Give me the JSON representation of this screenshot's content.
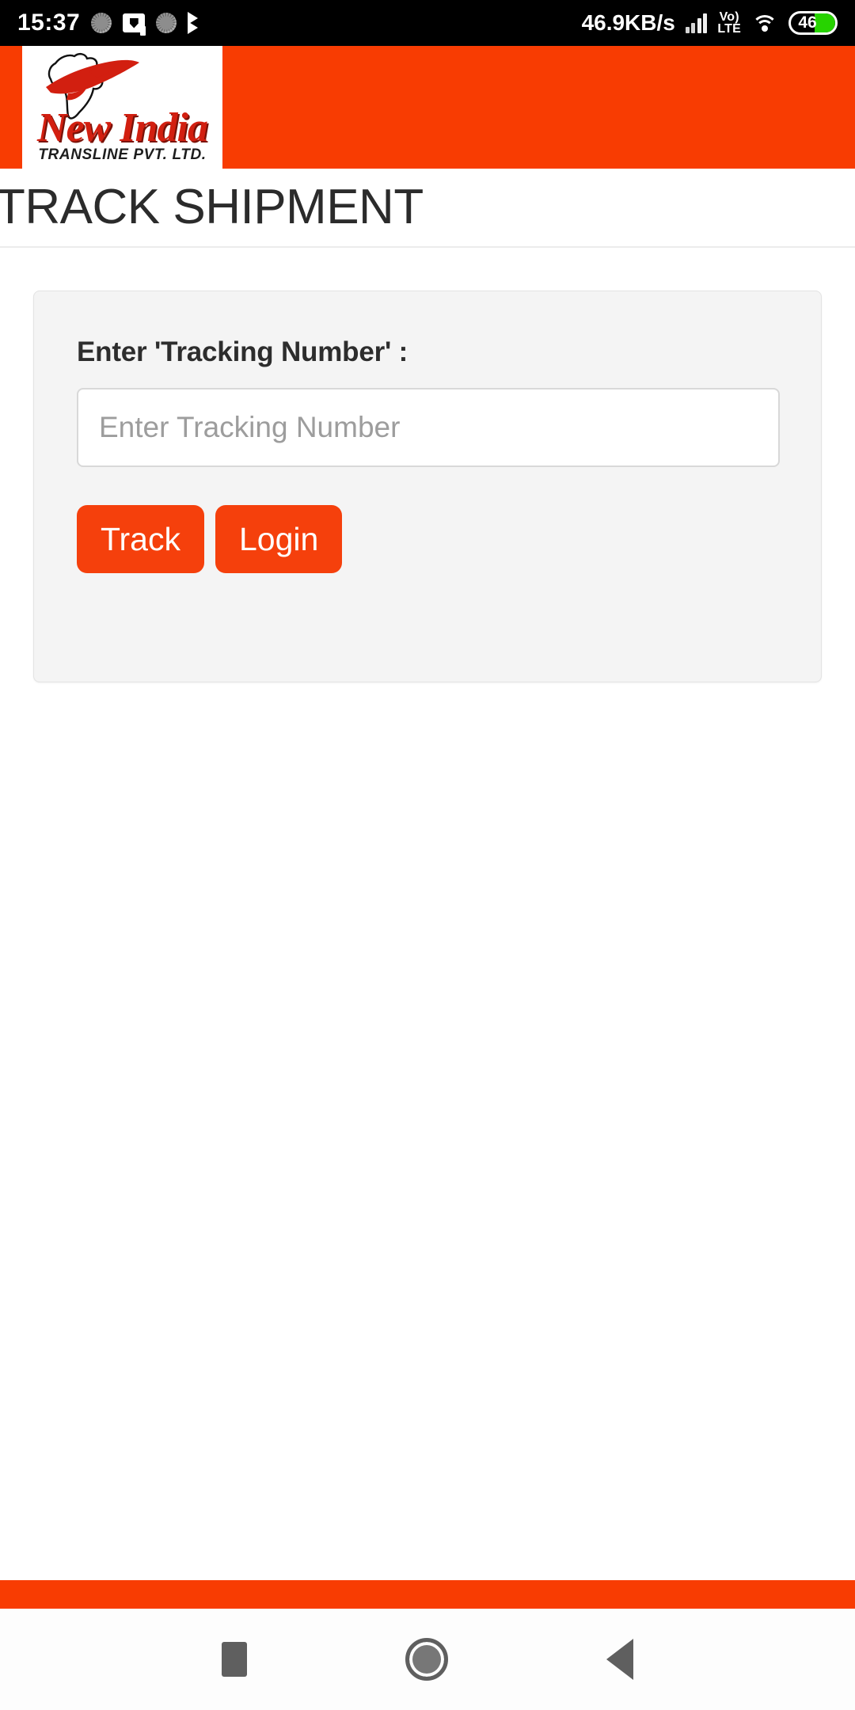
{
  "status_bar": {
    "time": "15:37",
    "network_speed": "46.9KB/s",
    "volte_line1": "Vo)",
    "volte_line2": "LTE",
    "battery_percent": "46",
    "icons": [
      "spinner-icon",
      "cast-icon",
      "spinner-icon",
      "chevron-double-down-icon",
      "signal-icon",
      "volte-icon",
      "wifi-icon",
      "battery-icon"
    ]
  },
  "header": {
    "logo_name": "New India",
    "logo_subtitle": "TRANSLINE PVT. LTD.",
    "brand_color": "#f83c02",
    "logo_red": "#d21f10"
  },
  "page": {
    "title": "TRACK SHIPMENT"
  },
  "form": {
    "label": "Enter 'Tracking Number' :",
    "input_value": "",
    "input_placeholder": "Enter Tracking Number",
    "track_button": "Track",
    "login_button": "Login",
    "button_color": "#f5400c"
  },
  "navbar": {
    "recents": "recents-square",
    "home": "home-circle",
    "back": "back-triangle"
  }
}
